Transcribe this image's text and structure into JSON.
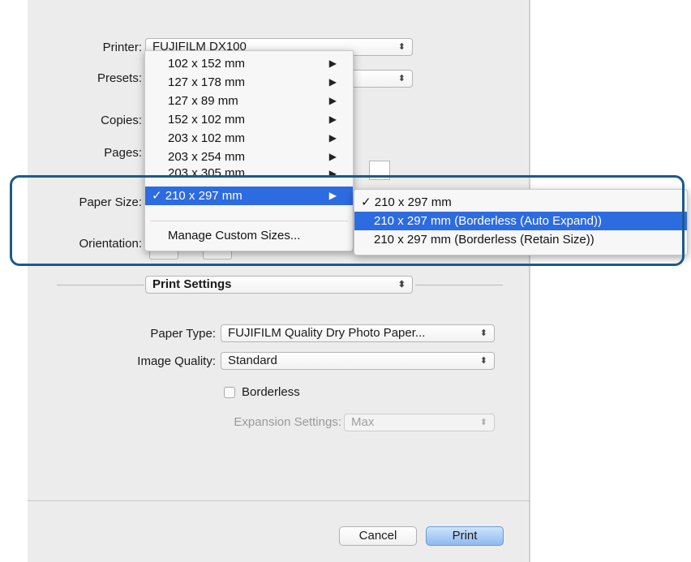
{
  "dialog": {
    "printer": {
      "label": "Printer:",
      "value": "FUJIFILM DX100"
    },
    "presets": {
      "label": "Presets:"
    },
    "copies": {
      "label": "Copies:"
    },
    "pages": {
      "label": "Pages:"
    },
    "paper_size": {
      "label": "Paper Size:"
    },
    "orientation": {
      "label": "Orientation:"
    },
    "section": {
      "value": "Print Settings"
    },
    "paper_type": {
      "label": "Paper Type:",
      "value": "FUJIFILM Quality Dry Photo Paper..."
    },
    "image_quality": {
      "label": "Image Quality:",
      "value": "Standard"
    },
    "borderless": {
      "label": "Borderless",
      "checked": false
    },
    "expansion": {
      "label": "Expansion Settings:",
      "value": "Max",
      "enabled": false
    },
    "buttons": {
      "cancel": "Cancel",
      "print": "Print"
    },
    "popup_arrows": "⬍"
  },
  "paper_size_menu": {
    "items": [
      {
        "label": "102 x 152 mm",
        "arrow": "▶"
      },
      {
        "label": "127 x 178 mm",
        "arrow": "▶"
      },
      {
        "label": "127 x 89 mm",
        "arrow": "▶"
      },
      {
        "label": "152 x 102 mm",
        "arrow": "▶"
      },
      {
        "label": "203 x 102 mm",
        "arrow": "▶"
      },
      {
        "label": "203 x 254 mm",
        "arrow": "▶"
      },
      {
        "label": "203 x 305 mm",
        "arrow": "▶"
      }
    ],
    "selected": {
      "label": "✓ 210 x 297 mm",
      "arrow": "▶"
    },
    "manage": "Manage Custom Sizes..."
  },
  "submenu": {
    "items": [
      {
        "label": "✓ 210 x 297 mm"
      },
      {
        "label": "210 x 297 mm (Borderless (Auto Expand))"
      },
      {
        "label": "210 x 297 mm (Borderless (Retain Size))"
      }
    ]
  },
  "colors": {
    "accent": "#2d6be0",
    "highlight_frame": "#1c5a8a"
  }
}
